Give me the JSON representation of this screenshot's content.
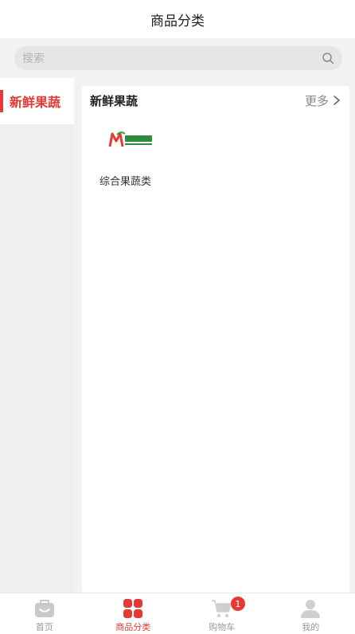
{
  "header": {
    "title": "商品分类"
  },
  "search": {
    "placeholder": "搜索",
    "icon": "search-icon"
  },
  "sidebar": {
    "items": [
      {
        "label": "新鲜果蔬",
        "active": true
      }
    ]
  },
  "panel": {
    "category_title": "新鲜果蔬",
    "more_label": "更多",
    "products": [
      {
        "name": "综合果蔬类",
        "logo": "moxianhui-logo"
      }
    ]
  },
  "tabbar": {
    "items": [
      {
        "label": "首页",
        "icon": "home-bag-icon",
        "active": false
      },
      {
        "label": "商品分类",
        "icon": "grid-icon",
        "active": true
      },
      {
        "label": "购物车",
        "icon": "cart-icon",
        "active": false,
        "badge": "1"
      },
      {
        "label": "我的",
        "icon": "user-icon",
        "active": false
      }
    ]
  },
  "colors": {
    "accent": "#e53935",
    "muted": "#999999",
    "background": "#f2f2f2"
  }
}
